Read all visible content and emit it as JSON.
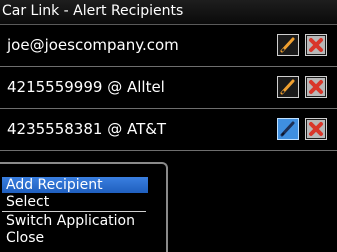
{
  "titlebar": {
    "title": "Car Link - Alert Recipients"
  },
  "recipients": [
    {
      "address": "joe@joescompany.com",
      "edit_icon": "pencil-icon",
      "delete_icon": "x-icon"
    },
    {
      "address": "4215559999 @ Alltel",
      "edit_icon": "pencil-icon",
      "delete_icon": "x-icon"
    },
    {
      "address": "4235558381 @ AT&T",
      "edit_icon": "pencil-icon",
      "delete_icon": "x-icon",
      "edit_focused": true
    }
  ],
  "menu": {
    "items": [
      {
        "label": "Add Recipient",
        "selected": true
      },
      {
        "label": "Select"
      },
      {
        "label": "Switch Application"
      },
      {
        "label": "Close"
      }
    ]
  },
  "colors": {
    "selection": "#2f74d6",
    "delete_red": "#d9362a",
    "pencil_orange": "#f0a030"
  }
}
